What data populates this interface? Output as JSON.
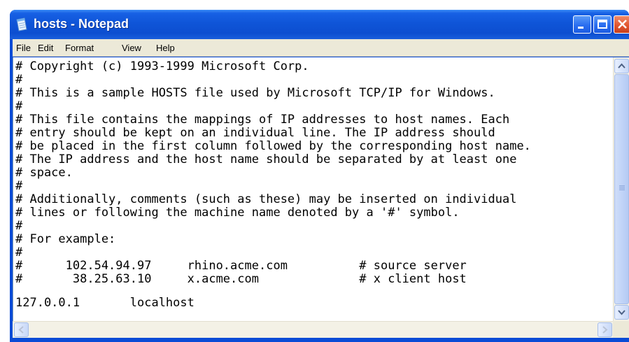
{
  "window": {
    "title": "hosts - Notepad"
  },
  "menu": {
    "items": [
      "File",
      "Edit",
      "Format",
      "View",
      "Help"
    ]
  },
  "editor": {
    "lines": [
      "# Copyright (c) 1993-1999 Microsoft Corp.",
      "#",
      "# This is a sample HOSTS file used by Microsoft TCP/IP for Windows.",
      "#",
      "# This file contains the mappings of IP addresses to host names. Each",
      "# entry should be kept on an individual line. The IP address should",
      "# be placed in the first column followed by the corresponding host name.",
      "# The IP address and the host name should be separated by at least one",
      "# space.",
      "#",
      "# Additionally, comments (such as these) may be inserted on individual",
      "# lines or following the machine name denoted by a '#' symbol.",
      "#",
      "# For example:",
      "#",
      "#      102.54.94.97     rhino.acme.com          # source server",
      "#       38.25.63.10     x.acme.com              # x client host",
      "",
      "127.0.0.1       localhost"
    ]
  },
  "icons": {
    "app": "notepad-icon",
    "minimize": "minimize-icon",
    "maximize": "maximize-icon",
    "close": "close-icon",
    "scroll_up": "arrow-up-icon",
    "scroll_down": "arrow-down-icon",
    "scroll_left": "arrow-left-icon",
    "scroll_right": "arrow-right-icon"
  },
  "colors": {
    "titlebar": "#0c4ed0",
    "close_button": "#e2562f",
    "menubar": "#ece9d8"
  }
}
